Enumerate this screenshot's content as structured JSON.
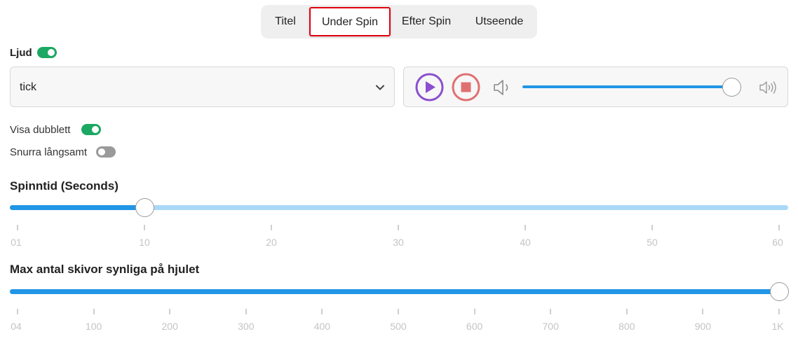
{
  "tabs": [
    {
      "label": "Titel"
    },
    {
      "label": "Under Spin",
      "active": true
    },
    {
      "label": "Efter Spin"
    },
    {
      "label": "Utseende"
    }
  ],
  "sound": {
    "label": "Ljud",
    "enabled": true,
    "selected": "tick"
  },
  "player": {
    "play_icon": "play-circle-icon",
    "stop_icon": "stop-circle-icon",
    "mute_icon": "speaker-low-icon",
    "loud_icon": "speaker-high-icon",
    "volume_fraction": 1.0
  },
  "options": {
    "show_duplicate": {
      "label": "Visa dubblett",
      "enabled": true
    },
    "spin_slow": {
      "label": "Snurra långsamt",
      "enabled": false
    }
  },
  "spin_time": {
    "title": "Spinntid (Seconds)",
    "value": 10,
    "min": 1,
    "max": 60,
    "ticks": [
      "01",
      "10",
      "20",
      "30",
      "40",
      "50",
      "60"
    ]
  },
  "max_slices": {
    "title": "Max antal skivor synliga på hjulet",
    "value": 1000,
    "min": 4,
    "max": 1000,
    "ticks": [
      "04",
      "100",
      "200",
      "300",
      "400",
      "500",
      "600",
      "700",
      "800",
      "900",
      "1K"
    ]
  },
  "colors": {
    "accent_blue": "#2196e6",
    "track_light": "#aad9f8",
    "toggle_on": "#1ba862",
    "toggle_off": "#9a9a9a",
    "play_purple": "#8b4fcf",
    "stop_red": "#e07070",
    "active_tab_border": "#e0000f"
  }
}
